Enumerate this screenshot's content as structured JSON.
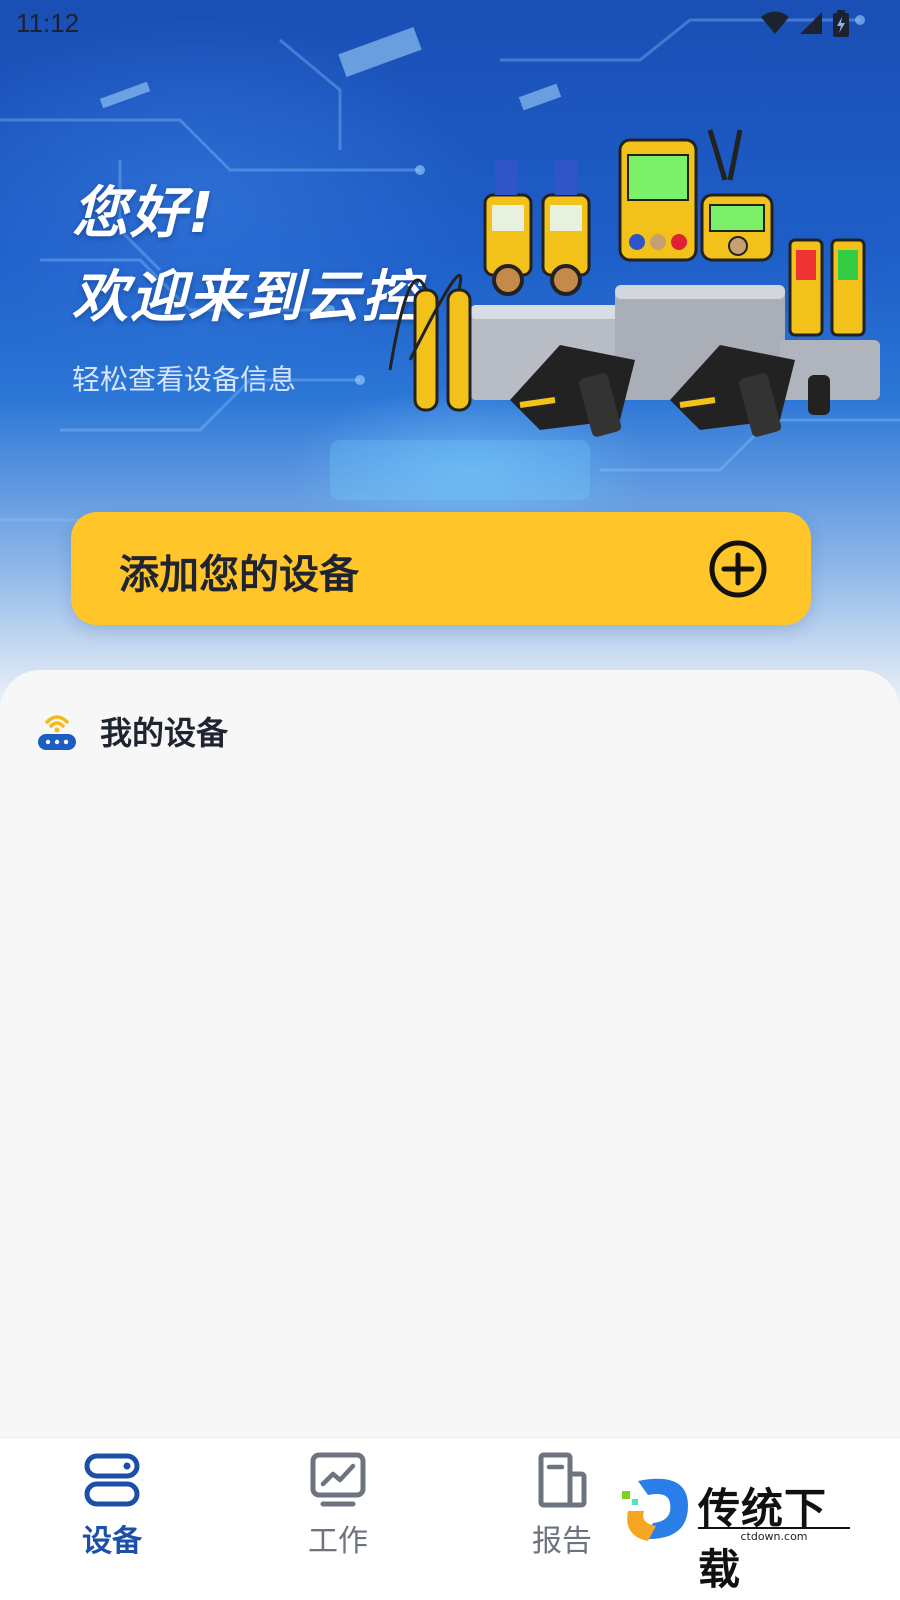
{
  "status_bar": {
    "time": "11:12",
    "icons": [
      "wifi-icon",
      "signal-icon",
      "battery-icon"
    ]
  },
  "hero": {
    "greeting_line1": "您好!",
    "greeting_line2": "欢迎来到云控",
    "subtitle": "轻松查看设备信息"
  },
  "add_device": {
    "label": "添加您的设备",
    "icon": "plus-circle-icon",
    "color": "#ffc529"
  },
  "my_devices": {
    "title": "我的设备",
    "icon": "router-icon"
  },
  "tab_bar": {
    "tabs": [
      {
        "label": "设备",
        "icon": "devices-icon",
        "active": true
      },
      {
        "label": "工作",
        "icon": "chart-monitor-icon",
        "active": false
      },
      {
        "label": "报告",
        "icon": "report-icon",
        "active": false
      }
    ],
    "active_color": "#1c4fa8"
  },
  "watermark": {
    "text": "传统下载",
    "domain": "ctdown.com"
  }
}
